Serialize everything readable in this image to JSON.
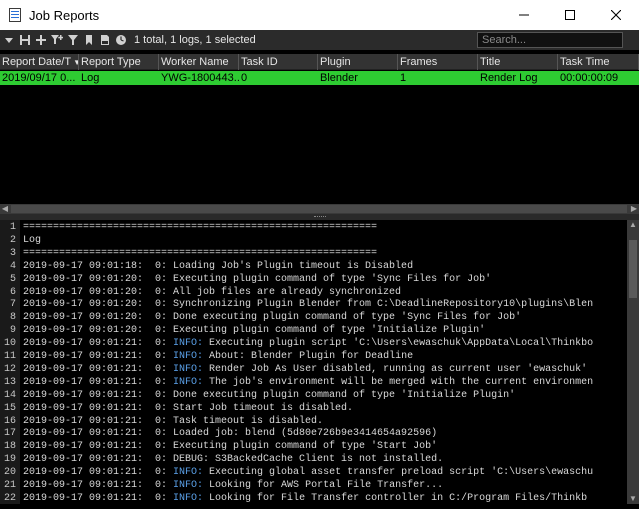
{
  "window": {
    "title": "Job Reports",
    "minimize_glyph": "—",
    "maximize_glyph": "☐",
    "close_glyph": "✕"
  },
  "toolbar": {
    "icons": [
      "menu-dropdown-icon",
      "save-icon",
      "add-icon",
      "filter-add-icon",
      "filter-icon",
      "bookmark-icon",
      "document-icon",
      "clock-icon"
    ],
    "summary": "1 total, 1 logs, 1 selected",
    "search_placeholder": "Search..."
  },
  "table": {
    "columns": [
      "Report Date/T",
      "Report Type",
      "Worker Name",
      "Task ID",
      "Plugin",
      "Frames",
      "Title",
      "Task Time"
    ],
    "sorted_column_index": 0,
    "rows": [
      {
        "cells": [
          "2019/09/17 0...",
          "Log",
          "YWG-1800443...",
          "0",
          "Blender",
          "1",
          "Render Log",
          "00:00:00:09"
        ],
        "selected": true
      }
    ],
    "selected_row_color": "#2ecc32"
  },
  "log": {
    "info_color": "#5aa0e8",
    "lines": [
      {
        "n": "1",
        "text": "==========================================================="
      },
      {
        "n": "2",
        "text": "Log"
      },
      {
        "n": "3",
        "text": "==========================================================="
      },
      {
        "n": "4",
        "text": "2019-09-17 09:01:18:  0: Loading Job's Plugin timeout is Disabled"
      },
      {
        "n": "5",
        "text": "2019-09-17 09:01:20:  0: Executing plugin command of type 'Sync Files for Job'"
      },
      {
        "n": "6",
        "text": "2019-09-17 09:01:20:  0: All job files are already synchronized"
      },
      {
        "n": "7",
        "text": "2019-09-17 09:01:20:  0: Synchronizing Plugin Blender from C:\\DeadlineRepository10\\plugins\\Blen"
      },
      {
        "n": "8",
        "text": "2019-09-17 09:01:20:  0: Done executing plugin command of type 'Sync Files for Job'"
      },
      {
        "n": "9",
        "text": "2019-09-17 09:01:20:  0: Executing plugin command of type 'Initialize Plugin'"
      },
      {
        "n": "10",
        "prefix": "2019-09-17 09:01:21:  0: ",
        "info": "INFO:",
        "text": " Executing plugin script 'C:\\Users\\ewaschuk\\AppData\\Local\\Thinkbo"
      },
      {
        "n": "11",
        "prefix": "2019-09-17 09:01:21:  0: ",
        "info": "INFO:",
        "text": " About: Blender Plugin for Deadline"
      },
      {
        "n": "12",
        "prefix": "2019-09-17 09:01:21:  0: ",
        "info": "INFO:",
        "text": " Render Job As User disabled, running as current user 'ewaschuk'"
      },
      {
        "n": "13",
        "prefix": "2019-09-17 09:01:21:  0: ",
        "info": "INFO:",
        "text": " The job's environment will be merged with the current environmen"
      },
      {
        "n": "14",
        "text": "2019-09-17 09:01:21:  0: Done executing plugin command of type 'Initialize Plugin'"
      },
      {
        "n": "15",
        "text": "2019-09-17 09:01:21:  0: Start Job timeout is disabled."
      },
      {
        "n": "16",
        "text": "2019-09-17 09:01:21:  0: Task timeout is disabled."
      },
      {
        "n": "17",
        "text": "2019-09-17 09:01:21:  0: Loaded job: blend (5d80e726b9e3414654a92596)"
      },
      {
        "n": "18",
        "text": "2019-09-17 09:01:21:  0: Executing plugin command of type 'Start Job'"
      },
      {
        "n": "19",
        "text": "2019-09-17 09:01:21:  0: DEBUG: S3BackedCache Client is not installed."
      },
      {
        "n": "20",
        "prefix": "2019-09-17 09:01:21:  0: ",
        "info": "INFO:",
        "text": " Executing global asset transfer preload script 'C:\\Users\\ewaschu"
      },
      {
        "n": "21",
        "prefix": "2019-09-17 09:01:21:  0: ",
        "info": "INFO:",
        "text": " Looking for AWS Portal File Transfer..."
      },
      {
        "n": "22",
        "prefix": "2019-09-17 09:01:21:  0: ",
        "info": "INFO:",
        "text": " Looking for File Transfer controller in C:/Program Files/Thinkb"
      }
    ]
  }
}
